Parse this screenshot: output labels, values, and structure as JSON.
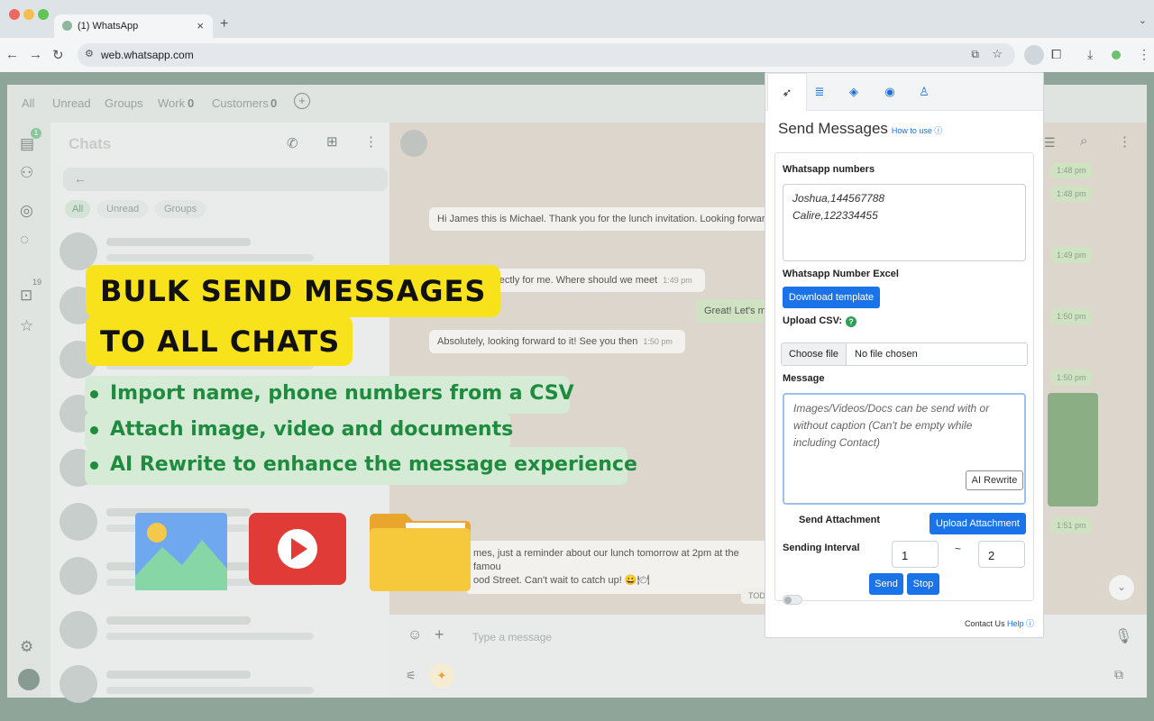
{
  "browser": {
    "tab_title": "(1) WhatsApp",
    "tab_close": "×",
    "new_tab": "+",
    "url": "web.whatsapp.com",
    "icons": [
      "back-icon",
      "forward-icon",
      "reload-icon",
      "tune-icon",
      "install-icon",
      "star-icon",
      "extension-icon",
      "puzzle-icon",
      "download-icon",
      "profile-icon",
      "menu-icon"
    ]
  },
  "filters": {
    "all": "All",
    "unread": "Unread",
    "groups": "Groups",
    "work": "Work",
    "work_count": "0",
    "customers": "Customers",
    "customers_count": "0",
    "add": "+"
  },
  "rail": {
    "badge": "1",
    "status_count": "19"
  },
  "chatlist": {
    "title": "Chats",
    "chips": [
      "All",
      "Unread",
      "Groups"
    ]
  },
  "messages": [
    {
      "text": "Hi James this is Michael. Thank you for the lunch invitation. Looking forwar",
      "time": ""
    },
    {
      "text": "rfectly for me. Where should we meet",
      "time": "1:49 pm"
    },
    {
      "text": "Great! Let's m",
      "time": ""
    },
    {
      "text": "Absolutely, looking forward to it! See you then",
      "time": "1:50 pm"
    },
    {
      "text": "mes, just a reminder about our lunch tomorrow at 2pm at the famou",
      "time": ""
    },
    {
      "text": "ood Street. Can't wait to catch up! 😀🍽",
      "time": ""
    }
  ],
  "timestamps": [
    "1:48 pm",
    "1:48 pm",
    "1:49 pm",
    "1:50 pm",
    "1:50 pm",
    "1:51 pm"
  ],
  "day_divider": "TOD",
  "composer": {
    "placeholder": "Type a message"
  },
  "promo": {
    "headline_1": "BULK SEND MESSAGES",
    "headline_2": "TO ALL CHATS",
    "features": [
      "Import name, phone numbers from a CSV",
      "Attach image, video and documents",
      "AI Rewrite to enhance the message experience"
    ],
    "colors": {
      "highlight": "#f7e21b",
      "feature_text": "#1e8b3f",
      "feature_bg": "#d5ebd5"
    }
  },
  "extension": {
    "tabs": [
      "send-icon",
      "list-icon",
      "audio-icon",
      "eye-icon",
      "user-icon"
    ],
    "title": "Send Messages",
    "how_to": "How to use ⓘ",
    "numbers_label": "Whatsapp numbers",
    "numbers_value": "Joshua,144567788\nCalire,122334455",
    "excel_label": "Whatsapp Number Excel",
    "download_template": "Download template",
    "upload_csv_label": "Upload CSV:",
    "choose_file": "Choose file",
    "no_file": "No file chosen",
    "message_label": "Message",
    "message_placeholder": "Images/Videos/Docs can be send with or without caption (Can't be empty while including Contact)",
    "ai_rewrite": "AI Rewrite",
    "send_attachment": "Send Attachment",
    "upload_attachment": "Upload Attachment",
    "sending_interval": "Sending Interval",
    "interval_from": "1",
    "interval_sep": "~",
    "interval_to": "2",
    "send": "Send",
    "stop": "Stop",
    "contact_us": "Contact Us",
    "help": "Help ⓘ",
    "accent": "#1a73e8"
  }
}
